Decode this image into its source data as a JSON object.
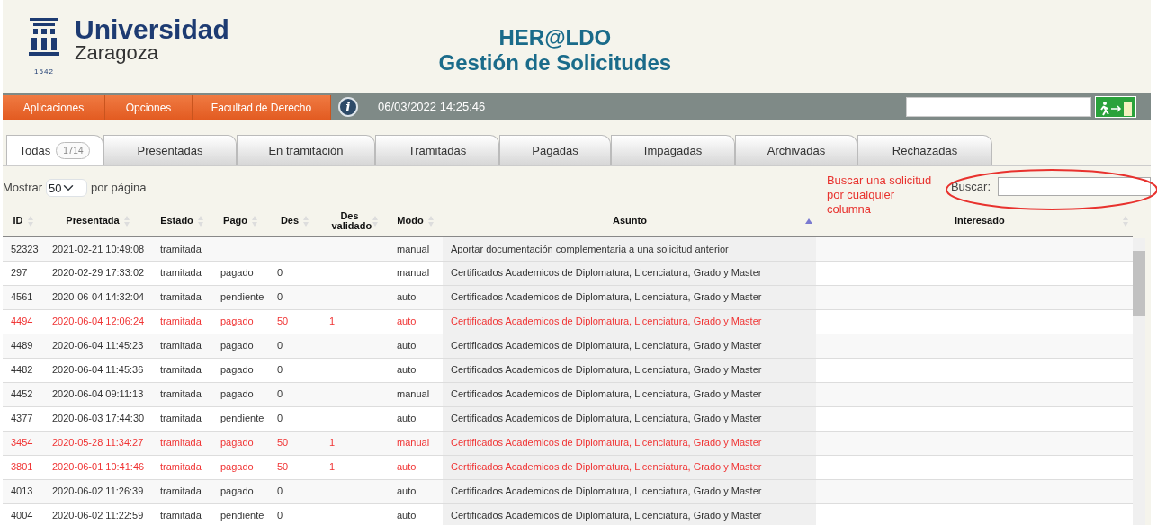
{
  "header": {
    "logo_name": "Universidad",
    "logo_city": "Zaragoza",
    "logo_year": "1542",
    "title": "HER@LDO",
    "subtitle": "Gestión de Solicitudes"
  },
  "menu": [
    "Aplicaciones",
    "Opciones",
    "Facultad de Derecho"
  ],
  "info_icon": "i",
  "datetime": "06/03/2022 14:25:46",
  "tabs": [
    {
      "label": "Todas",
      "count": "1714",
      "selected": true
    },
    {
      "label": "Presentadas",
      "selected": false
    },
    {
      "label": "En tramitación",
      "selected": false
    },
    {
      "label": "Tramitadas",
      "selected": false
    },
    {
      "label": "Pagadas",
      "selected": false
    },
    {
      "label": "Impagadas",
      "selected": false
    },
    {
      "label": "Archivadas",
      "selected": false
    },
    {
      "label": "Rechazadas",
      "selected": false
    }
  ],
  "page_size": {
    "before": "Mostrar",
    "value": "50",
    "after": "por página"
  },
  "annotation": "Buscar una solicitud por cualquier columna",
  "search": {
    "label": "Buscar:"
  },
  "table": {
    "columns": [
      {
        "label": "ID",
        "sorted": false
      },
      {
        "label": "Presentada",
        "sorted": false
      },
      {
        "label": "Estado",
        "sorted": false
      },
      {
        "label": "Pago",
        "sorted": false
      },
      {
        "label": "Des",
        "sorted": false
      },
      {
        "label": "Des validado",
        "sorted": false
      },
      {
        "label": "Modo",
        "sorted": false
      },
      {
        "label": "Asunto",
        "sorted": true
      },
      {
        "label": "Interesado",
        "sorted": false
      }
    ],
    "rows": [
      {
        "cells": [
          "52323",
          "2021-02-21 10:49:08",
          "tramitada",
          "",
          "",
          "",
          "manual",
          "Aportar documentación complementaria a una solicitud anterior"
        ],
        "highlighted": false
      },
      {
        "cells": [
          "297",
          "2020-02-29 17:33:02",
          "tramitada",
          "pagado",
          "0",
          "",
          "manual",
          "Certificados Academicos de Diplomatura, Licenciatura, Grado y Master"
        ],
        "highlighted": false
      },
      {
        "cells": [
          "4561",
          "2020-06-04 14:32:04",
          "tramitada",
          "pendiente",
          "0",
          "",
          "auto",
          "Certificados Academicos de Diplomatura, Licenciatura, Grado y Master"
        ],
        "highlighted": false
      },
      {
        "cells": [
          "4494",
          "2020-06-04 12:06:24",
          "tramitada",
          "pagado",
          "50",
          "1",
          "auto",
          "Certificados Academicos de Diplomatura, Licenciatura, Grado y Master"
        ],
        "highlighted": true
      },
      {
        "cells": [
          "4489",
          "2020-06-04 11:45:23",
          "tramitada",
          "pagado",
          "0",
          "",
          "auto",
          "Certificados Academicos de Diplomatura, Licenciatura, Grado y Master"
        ],
        "highlighted": false
      },
      {
        "cells": [
          "4482",
          "2020-06-04 11:45:36",
          "tramitada",
          "pagado",
          "0",
          "",
          "auto",
          "Certificados Academicos de Diplomatura, Licenciatura, Grado y Master"
        ],
        "highlighted": false
      },
      {
        "cells": [
          "4452",
          "2020-06-04 09:11:13",
          "tramitada",
          "pagado",
          "0",
          "",
          "manual",
          "Certificados Academicos de Diplomatura, Licenciatura, Grado y Master"
        ],
        "highlighted": false
      },
      {
        "cells": [
          "4377",
          "2020-06-03 17:44:30",
          "tramitada",
          "pendiente",
          "0",
          "",
          "auto",
          "Certificados Academicos de Diplomatura, Licenciatura, Grado y Master"
        ],
        "highlighted": false
      },
      {
        "cells": [
          "3454",
          "2020-05-28 11:34:27",
          "tramitada",
          "pagado",
          "50",
          "1",
          "manual",
          "Certificados Academicos de Diplomatura, Licenciatura, Grado y Master"
        ],
        "highlighted": true
      },
      {
        "cells": [
          "3801",
          "2020-06-01 10:41:46",
          "tramitada",
          "pagado",
          "50",
          "1",
          "auto",
          "Certificados Academicos de Diplomatura, Licenciatura, Grado y Master"
        ],
        "highlighted": true
      },
      {
        "cells": [
          "4013",
          "2020-06-02 11:26:39",
          "tramitada",
          "pagado",
          "0",
          "",
          "auto",
          "Certificados Academicos de Diplomatura, Licenciatura, Grado y Master"
        ],
        "highlighted": false
      },
      {
        "cells": [
          "4004",
          "2020-06-02 11:22:59",
          "tramitada",
          "pendiente",
          "0",
          "",
          "auto",
          "Certificados Academicos de Diplomatura, Licenciatura, Grado y Master"
        ],
        "highlighted": false
      }
    ]
  }
}
